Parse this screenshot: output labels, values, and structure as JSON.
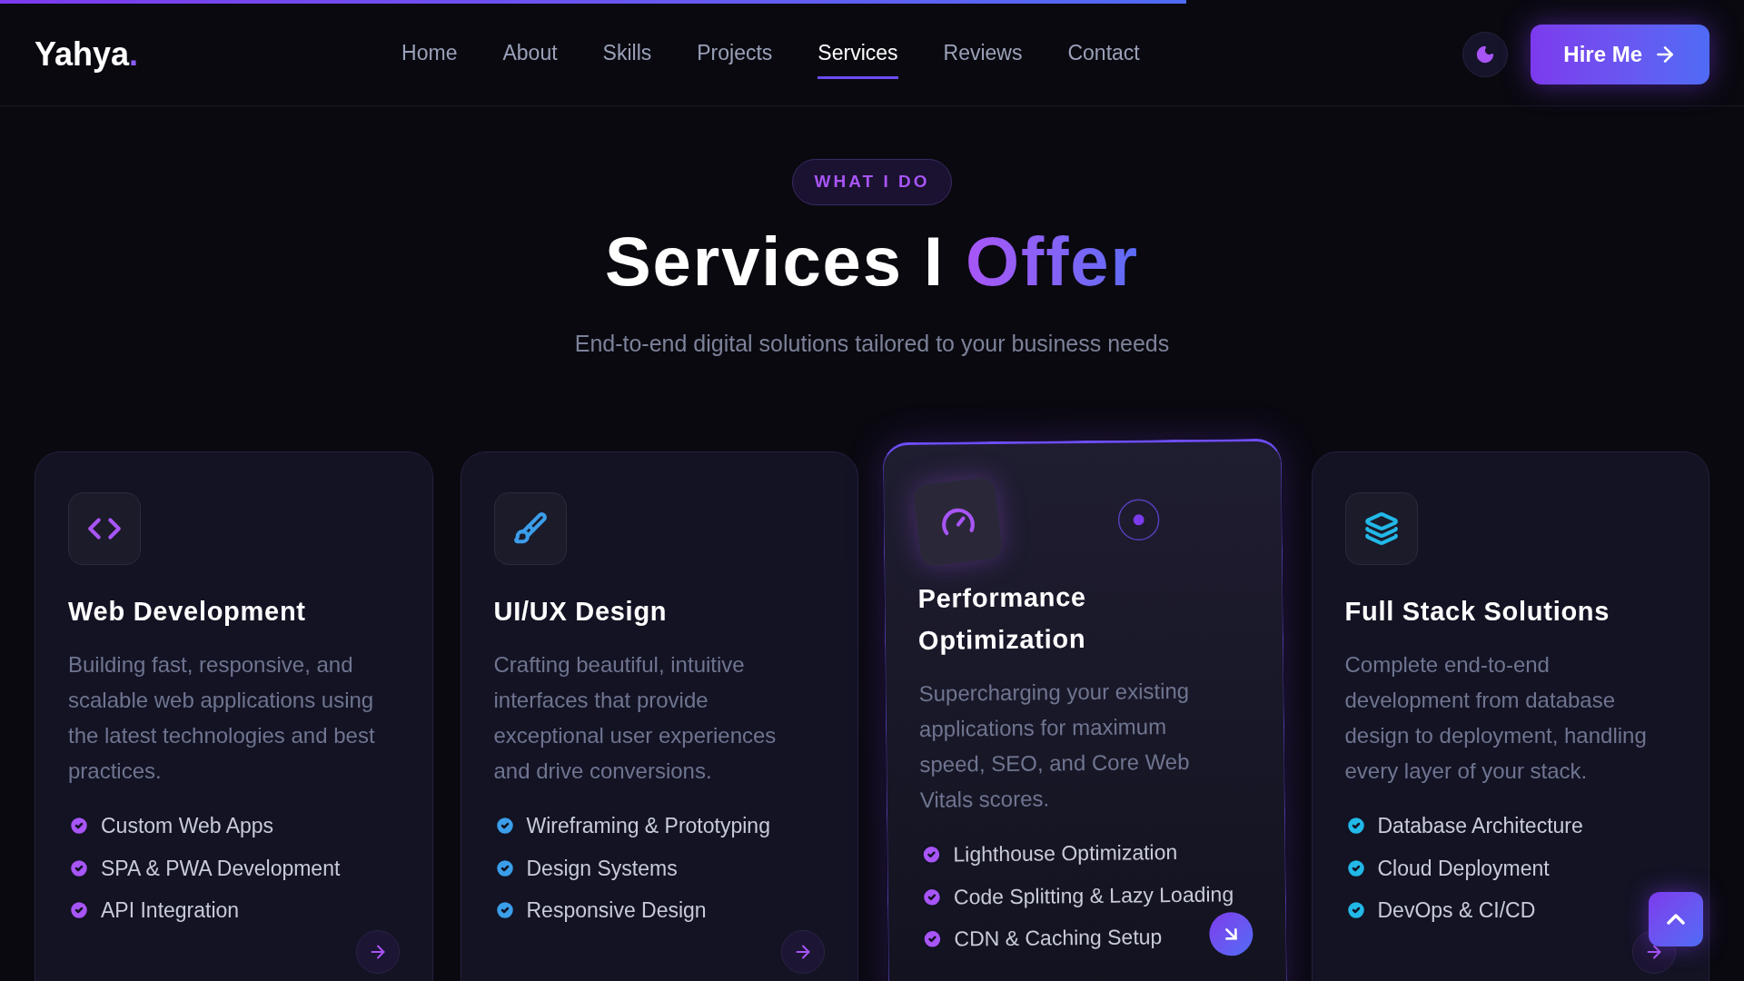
{
  "scroll_progress": {
    "level": 0.68
  },
  "nav": {
    "logo": "Yahya",
    "logo_dot": ".",
    "links": [
      {
        "label": "Home",
        "selected": false
      },
      {
        "label": "About",
        "selected": false
      },
      {
        "label": "Skills",
        "selected": false
      },
      {
        "label": "Projects",
        "selected": false
      },
      {
        "label": "Services",
        "selected": true
      },
      {
        "label": "Reviews",
        "selected": false
      },
      {
        "label": "Contact",
        "selected": false
      }
    ],
    "hire_button": "Hire Me"
  },
  "section": {
    "badge": "WHAT I DO",
    "title_lead": "Services I",
    "title_accent": "Offer",
    "subtitle": "End-to-end digital solutions tailored to your business needs"
  },
  "services": [
    {
      "kind": "code",
      "color": "#a855f7",
      "highlighted": false,
      "title": "Web Development",
      "description": "Building fast, responsive, and scalable web applications using the latest technologies and best practices.",
      "features": [
        "Custom Web Apps",
        "SPA & PWA Development",
        "API Integration"
      ]
    },
    {
      "kind": "brush",
      "color": "#3b9eea",
      "highlighted": false,
      "title": "UI/UX Design",
      "description": "Crafting beautiful, intuitive interfaces that provide exceptional user experiences and drive conversions.",
      "features": [
        "Wireframing & Prototyping",
        "Design Systems",
        "Responsive Design"
      ]
    },
    {
      "kind": "gauge",
      "color": "#a855f7",
      "highlighted": true,
      "title": "Performance Optimization",
      "description": "Supercharging your existing applications for maximum speed, SEO, and Core Web Vitals scores.",
      "features": [
        "Lighthouse Optimization",
        "Code Splitting & Lazy Loading",
        "CDN & Caching Setup"
      ]
    },
    {
      "kind": "layers",
      "color": "#22b8e8",
      "highlighted": false,
      "title": "Full Stack Solutions",
      "description": "Complete end-to-end development from database design to deployment, handling every layer of your stack.",
      "features": [
        "Database Architecture",
        "Cloud Deployment",
        "DevOps & CI/CD"
      ]
    }
  ]
}
